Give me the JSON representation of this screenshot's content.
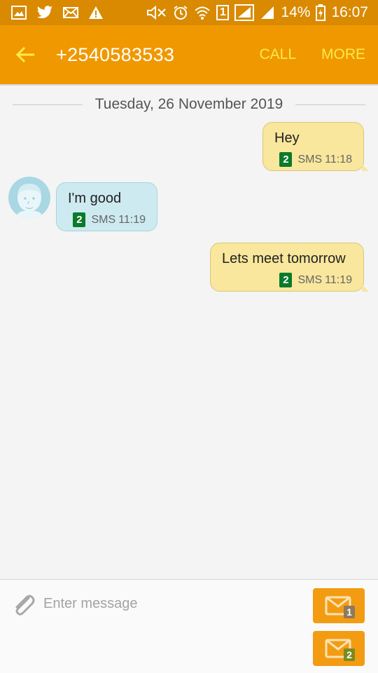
{
  "status_bar": {
    "battery": "14%",
    "time": "16:07",
    "sim_slot": "1",
    "icons": [
      "gallery-icon",
      "twitter-icon",
      "mail-icon",
      "warning-icon",
      "mute-icon",
      "alarm-icon",
      "wifi-icon",
      "signal-icon",
      "signal-icon",
      "battery-charging-icon"
    ]
  },
  "app_bar": {
    "title": "+2540583533",
    "actions": {
      "call": "CALL",
      "more": "MORE"
    },
    "accent_color": "#f09800",
    "action_color": "#ffe94a"
  },
  "conversation": {
    "date": "Tuesday, 26 November 2019",
    "messages": [
      {
        "direction": "sent",
        "text": "Hey",
        "sim": "2",
        "type": "SMS",
        "time": "11:18"
      },
      {
        "direction": "received",
        "text": "I'm good",
        "sim": "2",
        "type": "SMS",
        "time": "11:19"
      },
      {
        "direction": "sent",
        "text": "Lets meet tomorrow",
        "sim": "2",
        "type": "SMS",
        "time": "11:19"
      }
    ]
  },
  "composer": {
    "placeholder": "Enter message",
    "send_sim1": "1",
    "send_sim2": "2"
  }
}
